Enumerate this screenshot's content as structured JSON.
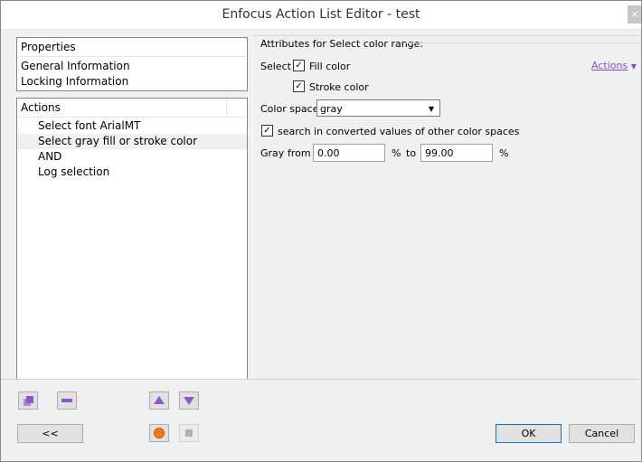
{
  "window": {
    "title": "Enfocus Action List Editor - test",
    "close_glyph": "×"
  },
  "properties_panel": {
    "header": "Properties",
    "items": [
      "General Information",
      "Locking Information"
    ]
  },
  "actions_panel": {
    "header": "Actions",
    "items": [
      {
        "label": "Select font ArialMT",
        "selected": false
      },
      {
        "label": "Select gray fill or stroke color",
        "selected": true
      },
      {
        "label": "AND",
        "selected": false
      },
      {
        "label": "Log selection",
        "selected": false
      }
    ]
  },
  "attributes": {
    "group_title": "Attributes for Select color range:",
    "actions_link": "Actions",
    "select_label": "Select",
    "fill_color": {
      "label": "Fill color",
      "checked": true
    },
    "stroke_color": {
      "label": "Stroke color",
      "checked": true
    },
    "color_space_label": "Color space",
    "color_space_value": "gray",
    "search_converted": {
      "label": "search in converted values of other color spaces",
      "checked": true
    },
    "gray_label": "Gray",
    "from_label": "from",
    "from_value": "0.00",
    "pct1": "%",
    "to_label": "to",
    "to_value": "99.00",
    "pct2": "%"
  },
  "toolbar": {
    "collapse_label": "<<",
    "ok_label": "OK",
    "cancel_label": "Cancel"
  },
  "icons": {
    "add": "add-action-icon",
    "remove": "remove-action-icon",
    "up": "move-up-icon",
    "down": "move-down-icon",
    "record": "record-icon",
    "stop": "stop-icon"
  },
  "colors": {
    "accent_purple": "#8a5bc8",
    "link_purple": "#7a4fbf",
    "record_orange": "#f07a1a",
    "default_button_border": "#0078d7"
  }
}
